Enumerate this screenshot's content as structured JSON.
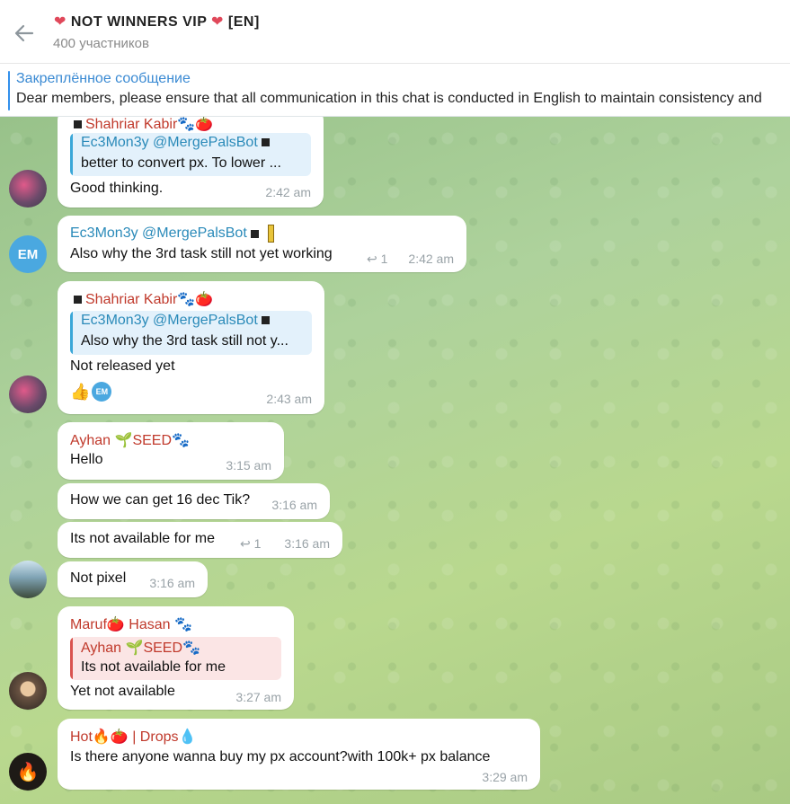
{
  "header": {
    "title": "NOT WINNERS VIP",
    "title_suffix": "[EN]",
    "subtitle": "400 участников"
  },
  "pinned": {
    "title": "Закреплённое сообщение",
    "text": "Dear members, please ensure that all communication in this chat is conducted in English to maintain consistency and"
  },
  "messages": [
    {
      "sender": "Shahriar Kabir",
      "quote_name": "Ec3Mon3y @MergePalsBot",
      "quote_text": "better to convert px.  To lower ...",
      "text": "Good thinking.",
      "time": "2:42 am"
    },
    {
      "sender": "Ec3Mon3y @MergePalsBot",
      "text": "Also why the 3rd task still not yet working",
      "reply_count": "1",
      "time": "2:42 am"
    },
    {
      "sender": "Shahriar Kabir",
      "quote_name": "Ec3Mon3y @MergePalsBot",
      "quote_text": "Also why the 3rd task still not y...",
      "text": "Not released yet",
      "reaction_avatar": "EM",
      "time": "2:43 am"
    },
    {
      "sender": "Ayhan",
      "sender_suffix": "SEED",
      "text": "Hello",
      "time": "3:15 am"
    },
    {
      "text": "How we can get 16 dec Tik?",
      "time": "3:16 am"
    },
    {
      "text": "Its not available for me",
      "reply_count": "1",
      "time": "3:16 am"
    },
    {
      "text": "Not pixel",
      "time": "3:16 am"
    },
    {
      "sender": "Maruf",
      "sender_rest": "Hasan",
      "quote_name": "Ayhan",
      "quote_name_suffix": "SEED",
      "quote_text": "Its not available for me",
      "text": "Yet not available",
      "time": "3:27 am"
    },
    {
      "sender": "Hot",
      "sender_rest": "| Drops",
      "text": "Is there anyone wanna buy my px account?with 100k+ px balance",
      "time": "3:29 am"
    }
  ],
  "avatars": {
    "em_initials": "EM"
  },
  "colors": {
    "accent": "#3390ec",
    "sender_red": "#c0392b",
    "sender_blue": "#2a8ab9",
    "chat_bg": "#a9cc8e"
  }
}
